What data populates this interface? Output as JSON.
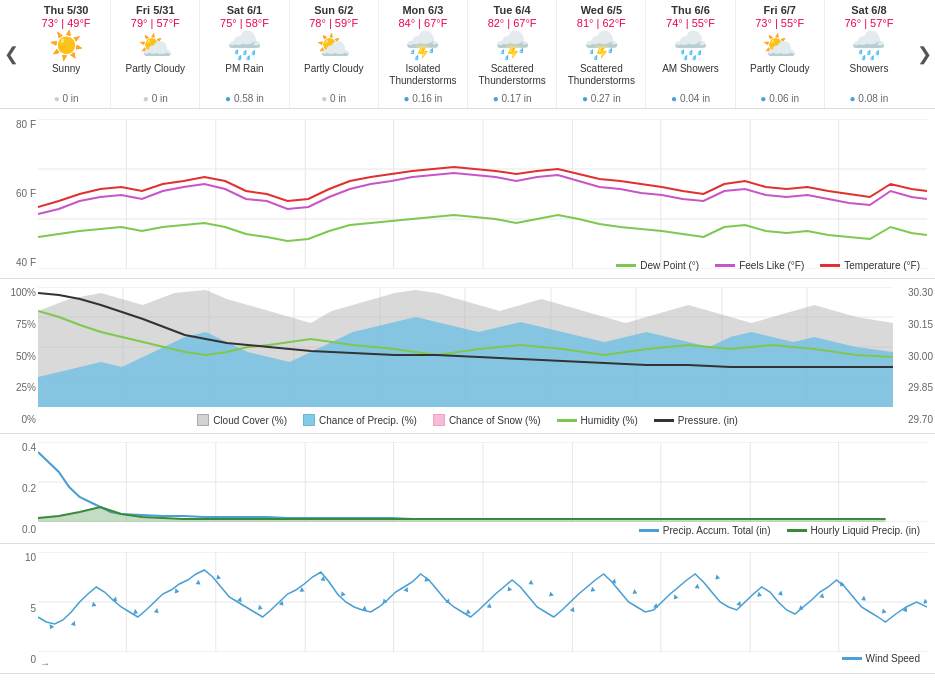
{
  "nav": {
    "prev_label": "❮",
    "next_label": "❯"
  },
  "days": [
    {
      "date": "Thu 5/30",
      "high": "73°",
      "low": "49°F",
      "temps_display": "73° | 49°F",
      "icon": "☀️",
      "condition": "Sunny",
      "precip": "0 in",
      "precip_color": "#ccc"
    },
    {
      "date": "Fri 5/31",
      "high": "79°",
      "low": "57°F",
      "temps_display": "79° | 57°F",
      "icon": "⛅",
      "condition": "Partly Cloudy",
      "precip": "0 in",
      "precip_color": "#ccc"
    },
    {
      "date": "Sat 6/1",
      "high": "75°",
      "low": "58°F",
      "temps_display": "75° | 58°F",
      "icon": "🌧️",
      "condition": "PM Rain",
      "precip": "0.58 in",
      "precip_color": "#4a9fd4"
    },
    {
      "date": "Sun 6/2",
      "high": "78°",
      "low": "59°F",
      "temps_display": "78° | 59°F",
      "icon": "⛅",
      "condition": "Partly Cloudy",
      "precip": "0 in",
      "precip_color": "#ccc"
    },
    {
      "date": "Mon 6/3",
      "high": "84°",
      "low": "67°F",
      "temps_display": "84° | 67°F",
      "icon": "⛈️",
      "condition": "Isolated Thunderstorms",
      "precip": "0.16 in",
      "precip_color": "#4a9fd4"
    },
    {
      "date": "Tue 6/4",
      "high": "82°",
      "low": "67°F",
      "temps_display": "82° | 67°F",
      "icon": "⛈️",
      "condition": "Scattered Thunderstorms",
      "precip": "0.17 in",
      "precip_color": "#4a9fd4"
    },
    {
      "date": "Wed 6/5",
      "high": "81°",
      "low": "62°F",
      "temps_display": "81° | 62°F",
      "icon": "⛈️",
      "condition": "Scattered Thunderstorms",
      "precip": "0.27 in",
      "precip_color": "#4a9fd4"
    },
    {
      "date": "Thu 6/6",
      "high": "74°",
      "low": "55°F",
      "temps_display": "74° | 55°F",
      "icon": "🌧️",
      "condition": "AM Showers",
      "precip": "0.04 in",
      "precip_color": "#4a9fd4"
    },
    {
      "date": "Fri 6/7",
      "high": "73°",
      "low": "55°F",
      "temps_display": "73° | 55°F",
      "icon": "⛅",
      "condition": "Partly Cloudy",
      "precip": "0.06 in",
      "precip_color": "#4a9fd4"
    },
    {
      "date": "Sat 6/8",
      "high": "76°",
      "low": "57°F",
      "temps_display": "76° | 57°F",
      "icon": "🌧️",
      "condition": "Showers",
      "precip": "0.08 in",
      "precip_color": "#4a9fd4"
    }
  ],
  "temp_chart": {
    "y_labels": [
      "80 F",
      "60 F",
      "40 F"
    ],
    "legend": [
      {
        "label": "Dew Point (°)",
        "color": "#7ec850",
        "type": "line"
      },
      {
        "label": "Feels Like (°F)",
        "color": "#c855c8",
        "type": "line"
      },
      {
        "label": "Temperature (°F)",
        "color": "#e03030",
        "type": "line"
      }
    ]
  },
  "precip_chart": {
    "y_labels": [
      "100%",
      "75%",
      "50%",
      "25%",
      "0%"
    ],
    "y_labels_right": [
      "30.30",
      "30.15",
      "30.00",
      "29.85",
      "29.70"
    ],
    "legend": [
      {
        "label": "Cloud Cover (%)",
        "color": "#c0c0c0",
        "type": "box"
      },
      {
        "label": "Chance of Precip. (%)",
        "color": "#87ceeb",
        "type": "box"
      },
      {
        "label": "Chance of Snow (%)",
        "color": "#f4a0c0",
        "type": "box"
      },
      {
        "label": "Humidity (%)",
        "color": "#7ec850",
        "type": "line"
      },
      {
        "label": "Pressure. (in)",
        "color": "#333",
        "type": "line"
      }
    ]
  },
  "accum_chart": {
    "y_labels": [
      "0.4",
      "0.2",
      "0.0"
    ],
    "legend": [
      {
        "label": "Precip. Accum. Total (in)",
        "color": "#4a9fd4",
        "type": "line"
      },
      {
        "label": "Hourly Liquid Precip. (in)",
        "color": "#3a8a3a",
        "type": "line"
      }
    ]
  },
  "wind_chart": {
    "y_labels": [
      "10",
      "5",
      "0"
    ],
    "legend": [
      {
        "label": "Wind Speed",
        "color": "#4a9fd4",
        "type": "line"
      }
    ],
    "arrow_label": "→"
  }
}
